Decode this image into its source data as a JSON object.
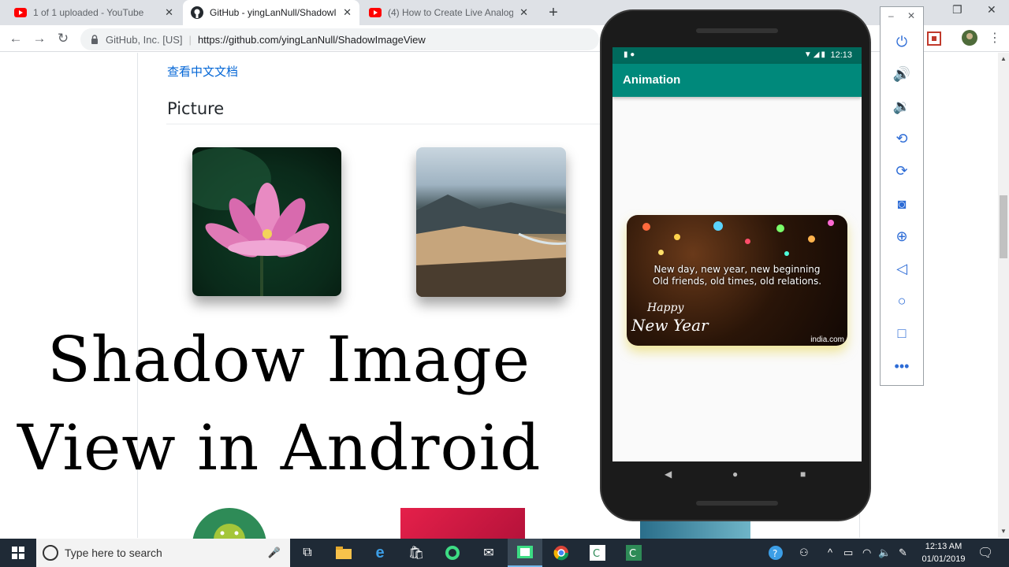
{
  "browser": {
    "tabs": [
      {
        "title": "1 of 1 uploaded - YouTube",
        "icon": "youtube-icon",
        "active": false
      },
      {
        "title": "GitHub - yingLanNull/ShadowIm",
        "icon": "github-icon",
        "active": true
      },
      {
        "title": "(4) How to Create Live Analog Cl",
        "icon": "youtube-icon",
        "active": false
      }
    ],
    "new_tab": "+",
    "omnibox": {
      "org": "GitHub, Inc. [US]",
      "url": "https://github.com/yingLanNull/ShadowImageView"
    }
  },
  "page": {
    "doc_link": "查看中文文档",
    "section_heading": "Picture",
    "overlay_line1": "Shadow Image",
    "overlay_line2": "View in Android"
  },
  "emulator": {
    "status_time": "12:13",
    "app_title": "Animation",
    "card": {
      "line1": "New day, new year, new beginning",
      "line2": "Old friends, old times, old relations.",
      "happy": "Happy",
      "new_year": "New Year",
      "brand": "india.com"
    },
    "side_controls": [
      "power-icon",
      "volume-up-icon",
      "volume-down-icon",
      "rotate-left-icon",
      "rotate-right-icon",
      "camera-icon",
      "zoom-icon",
      "back-icon",
      "home-icon",
      "overview-icon",
      "more-icon"
    ]
  },
  "taskbar": {
    "search_placeholder": "Type here to search",
    "clock_time": "12:13 AM",
    "clock_date": "01/01/2019"
  },
  "colors": {
    "app_bar": "#00897b",
    "status_bar": "#00695c",
    "link": "#0366d6",
    "taskbar": "#1f2a36"
  }
}
